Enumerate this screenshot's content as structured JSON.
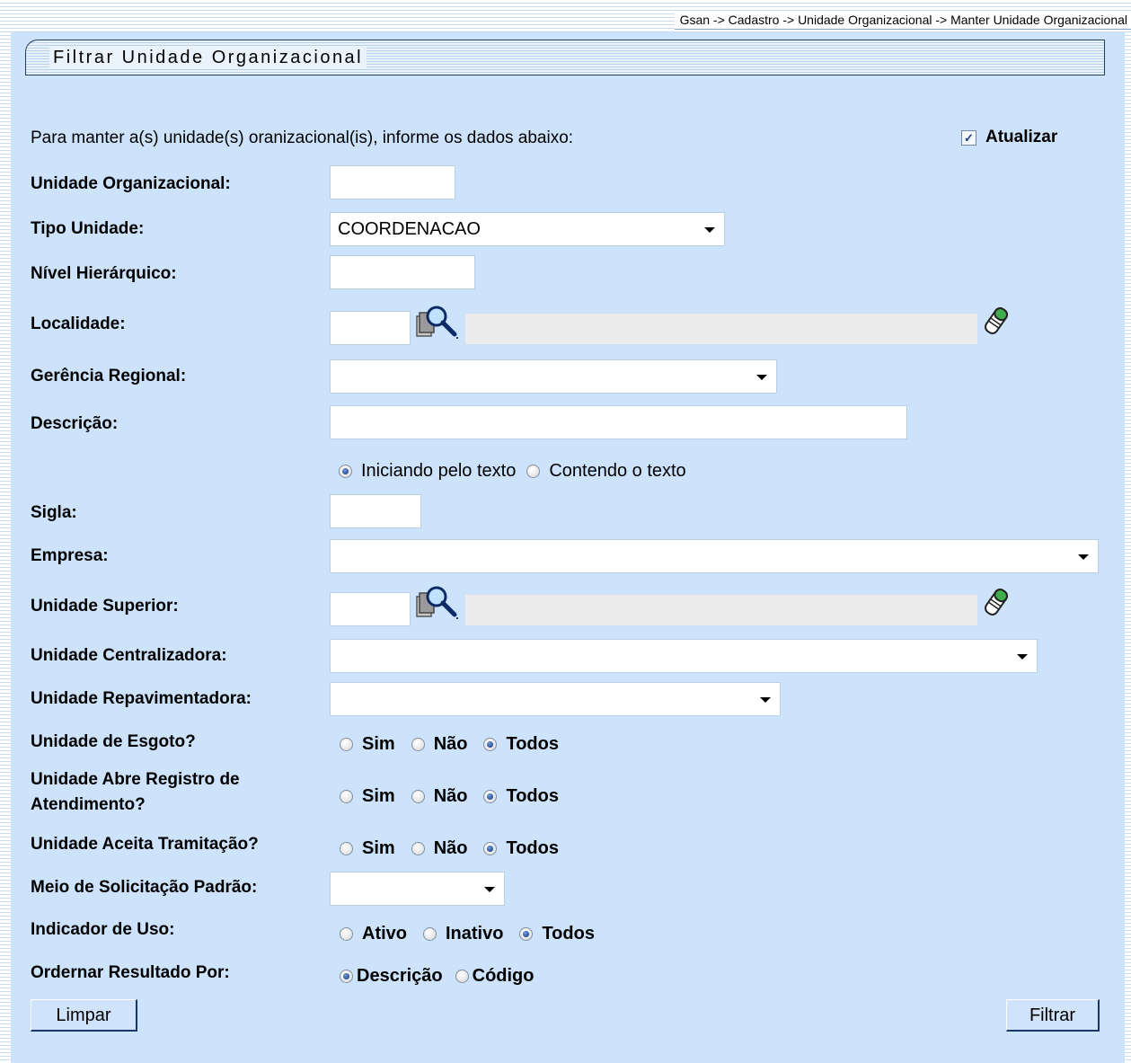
{
  "breadcrumb": "Gsan -> Cadastro -> Unidade Organizacional -> Manter Unidade Organizacional",
  "title": "Filtrar Unidade Organizacional",
  "intro": "Para manter a(s) unidade(s) oranizacional(is), informe os dados abaixo:",
  "atualizar": {
    "label": "Atualizar",
    "checked": true,
    "mark": "✓"
  },
  "fields": {
    "unidade_organizacional": {
      "label": "Unidade Organizacional:",
      "value": ""
    },
    "tipo_unidade": {
      "label": "Tipo Unidade:",
      "value": "COORDENACAO"
    },
    "nivel_hierarquico": {
      "label": "Nível Hierárquico:",
      "value": ""
    },
    "localidade": {
      "label": "Localidade:",
      "value": ""
    },
    "gerencia_regional": {
      "label": "Gerência Regional:",
      "value": ""
    },
    "descricao": {
      "label": "Descrição:",
      "value": ""
    },
    "descricao_mode": {
      "opt1": "Iniciando pelo texto",
      "opt2": "Contendo o texto",
      "selected": 1
    },
    "sigla": {
      "label": "Sigla:",
      "value": ""
    },
    "empresa": {
      "label": "Empresa:",
      "value": ""
    },
    "unidade_superior": {
      "label": "Unidade Superior:",
      "value": ""
    },
    "unidade_centralizadora": {
      "label": "Unidade Centralizadora:",
      "value": ""
    },
    "unidade_repavimentadora": {
      "label": "Unidade Repavimentadora:",
      "value": ""
    },
    "unidade_esgoto": {
      "label": "Unidade de Esgoto?",
      "selected": "Todos"
    },
    "unidade_abre_registro": {
      "label_line1": "Unidade Abre Registro de",
      "label_line2": "Atendimento?",
      "selected": "Todos"
    },
    "unidade_aceita_tramitacao": {
      "label": "Unidade Aceita Tramitação?",
      "selected": "Todos"
    },
    "meio_solicitacao": {
      "label": "Meio de Solicitação Padrão:",
      "value": ""
    },
    "indicador_uso": {
      "label": "Indicador de Uso:",
      "opt1": "Ativo",
      "opt2": "Inativo",
      "opt3": "Todos",
      "selected": "Todos"
    },
    "ordenar": {
      "label": "Ordernar Resultado Por:",
      "opt1": "Descrição",
      "opt2": "Código",
      "selected": "Descrição"
    }
  },
  "yesno": {
    "sim": "Sim",
    "nao": "Não",
    "todos": "Todos"
  },
  "buttons": {
    "limpar": "Limpar",
    "filtrar": "Filtrar"
  },
  "icons": {
    "lookup": "search-lookup-icon",
    "eraser": "eraser-icon"
  },
  "colors": {
    "panel": "#cce3fb",
    "title_border": "#233b5a",
    "readonly": "#ececec"
  }
}
